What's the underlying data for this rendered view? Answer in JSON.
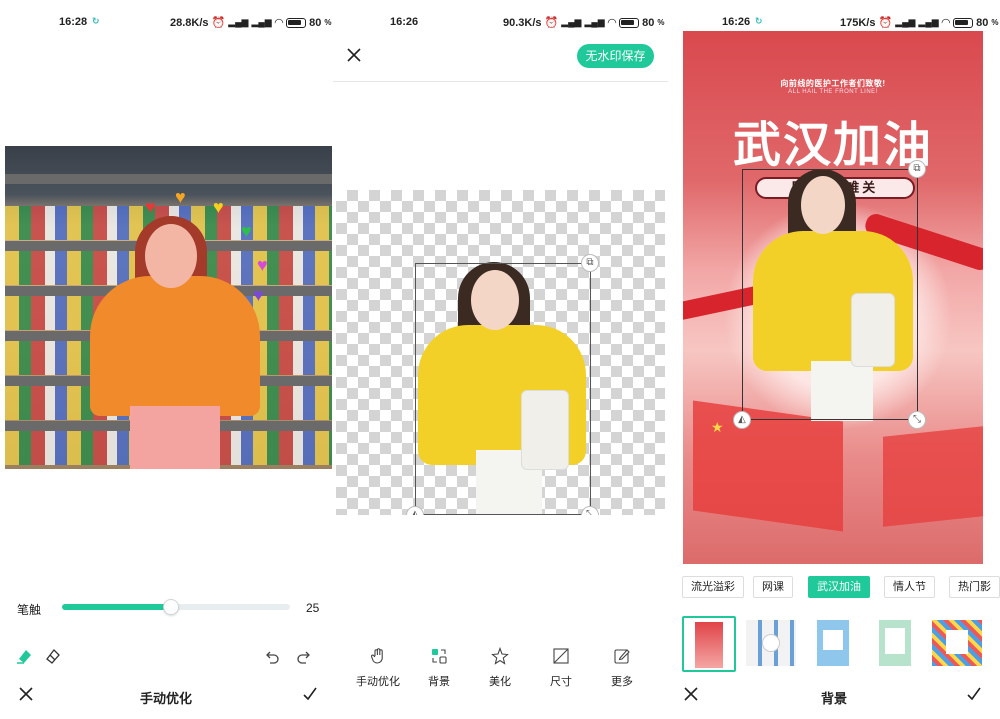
{
  "panel1": {
    "status": {
      "time": "16:28",
      "speed": "28.8K/s",
      "battery": "80"
    },
    "brush": {
      "label": "笔触",
      "value": "25",
      "fill_fraction": 0.48
    },
    "bottom": {
      "title": "手动优化"
    },
    "icons": {
      "erase": "eraser-icon",
      "restore": "restore-eraser-icon",
      "undo": "undo-icon",
      "redo": "redo-icon",
      "close": "close-icon",
      "confirm": "check-icon"
    }
  },
  "panel2": {
    "status": {
      "time": "16:26",
      "speed": "90.3K/s",
      "battery": "80"
    },
    "header": {
      "save_label": "无水印保存"
    },
    "tools": [
      {
        "label": "手动优化",
        "icon": "hand-icon"
      },
      {
        "label": "背景",
        "icon": "background-swap-icon"
      },
      {
        "label": "美化",
        "icon": "star-beautify-icon"
      },
      {
        "label": "尺寸",
        "icon": "crop-size-icon"
      },
      {
        "label": "更多",
        "icon": "edit-more-icon"
      }
    ]
  },
  "panel3": {
    "status": {
      "time": "16:26",
      "speed": "175K/s",
      "battery": "80"
    },
    "poster": {
      "line1": "向前线的医护工作者们致敬!",
      "line2": "ALL HAIL THE FRONT LINE!",
      "title": "武汉加油",
      "slogan": "同舟  渡难关"
    },
    "categories": [
      "流光溢彩",
      "网课",
      "武汉加油",
      "情人节",
      "热门影"
    ],
    "active_category": "武汉加油",
    "bottom": {
      "title": "背景"
    }
  }
}
